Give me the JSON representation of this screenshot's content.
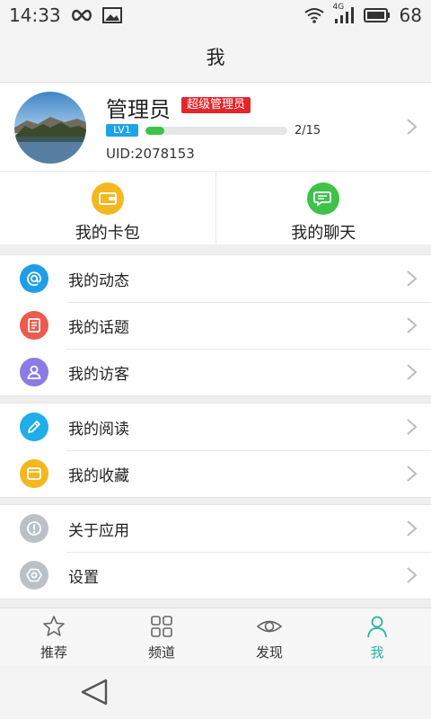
{
  "status_bar": {
    "time": "14:33",
    "battery": "68",
    "network_label": "4G"
  },
  "header": {
    "title": "我"
  },
  "profile": {
    "name": "管理员",
    "role_badge": "超级管理员",
    "level": "LV1",
    "exp_progress": 0.133,
    "exp_text": "2/15",
    "uid": "UID:2078153"
  },
  "quick_actions": [
    {
      "label": "我的卡包",
      "icon": "wallet-icon",
      "color": "#f3b81f"
    },
    {
      "label": "我的聊天",
      "icon": "chat-icon",
      "color": "#3ec24a"
    }
  ],
  "menu_groups": [
    [
      {
        "label": "我的动态",
        "icon": "at-icon",
        "color": "#1e9ee8"
      },
      {
        "label": "我的话题",
        "icon": "document-icon",
        "color": "#ec5b4e"
      },
      {
        "label": "我的访客",
        "icon": "person-icon",
        "color": "#8a7be6"
      }
    ],
    [
      {
        "label": "我的阅读",
        "icon": "pencil-icon",
        "color": "#1eaee8"
      },
      {
        "label": "我的收藏",
        "icon": "folder-icon",
        "color": "#f3b81f"
      }
    ],
    [
      {
        "label": "关于应用",
        "icon": "info-icon",
        "color": "#b9c1c7"
      },
      {
        "label": "设置",
        "icon": "settings-icon",
        "color": "#b9c1c7"
      }
    ]
  ],
  "tabs": [
    {
      "label": "推荐",
      "icon": "star-icon",
      "active": false
    },
    {
      "label": "频道",
      "icon": "grid-icon",
      "active": false
    },
    {
      "label": "发现",
      "icon": "eye-icon",
      "active": false
    },
    {
      "label": "我",
      "icon": "person-icon",
      "active": true
    }
  ],
  "colors": {
    "accent": "#2bb3a0",
    "admin_badge": "#e4262b",
    "level_badge": "#1ea3e8",
    "progress": "#3ec24a"
  }
}
